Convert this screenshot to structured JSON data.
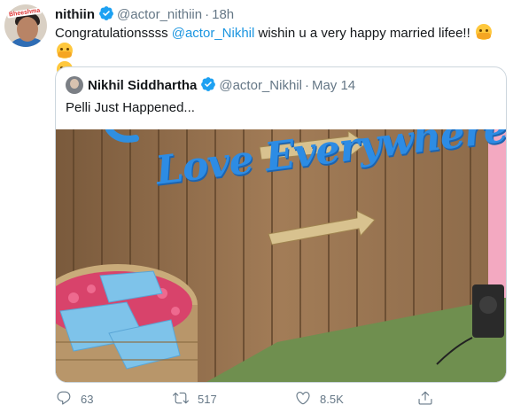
{
  "tweet": {
    "author_name": "nithiin",
    "author_handle": "@actor_nithiin",
    "separator": "·",
    "time": "18h",
    "text_part1": "Congratulationssss ",
    "mention": "@actor_Nikhil",
    "text_part2": " wishin u a very happy married lifee!! "
  },
  "quoted": {
    "author_name": "Nikhil Siddhartha",
    "author_handle": "@actor_Nikhil",
    "separator": "·",
    "date": "May 14",
    "text": "Pelli Just Happened..."
  },
  "photo": {
    "sign_text": "Love Everywhere"
  },
  "actions": {
    "reply_count": "63",
    "retweet_count": "517",
    "like_count": "8.5K"
  },
  "colors": {
    "accent": "#1b95e0",
    "secondary_text": "#657786",
    "border": "#ccd6dd"
  },
  "icons": [
    "verified-badge-icon",
    "hugging-face-emoji",
    "reply-icon",
    "retweet-icon",
    "like-icon",
    "share-icon"
  ]
}
